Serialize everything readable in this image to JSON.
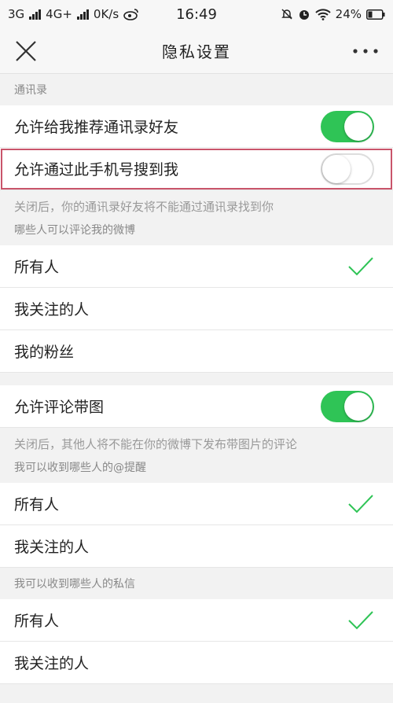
{
  "status": {
    "carrier1": "3G",
    "carrier2": "4G+",
    "speed": "0K/s",
    "time": "16:49",
    "battery": "24%",
    "icons": [
      "signal-icon",
      "weibo-icon",
      "mute-icon",
      "alarm-icon",
      "wifi-icon",
      "battery-icon"
    ]
  },
  "nav": {
    "title": "隐私设置",
    "close_icon": "close-icon",
    "more_icon": "more-icon"
  },
  "contacts": {
    "label": "通讯录",
    "recommend": {
      "label": "允许给我推荐通讯录好友",
      "on": true
    },
    "phone_search": {
      "label": "允许通过此手机号搜到我",
      "on": false
    },
    "hint": "关闭后，你的通讯录好友将不能通过通讯录找到你"
  },
  "comment": {
    "label": "哪些人可以评论我的微博",
    "options": [
      "所有人",
      "我关注的人",
      "我的粉丝"
    ],
    "selected": 0
  },
  "comment_image": {
    "label": "允许评论带图",
    "on": true,
    "hint": "关闭后，其他人将不能在你的微博下发布带图片的评论"
  },
  "mention": {
    "label": "我可以收到哪些人的@提醒",
    "options": [
      "所有人",
      "我关注的人"
    ],
    "selected": 0
  },
  "dm": {
    "label": "我可以收到哪些人的私信",
    "options": [
      "所有人",
      "我关注的人"
    ],
    "selected": 0
  },
  "colors": {
    "accent": "#2fc456",
    "highlight": "#c9546a"
  }
}
